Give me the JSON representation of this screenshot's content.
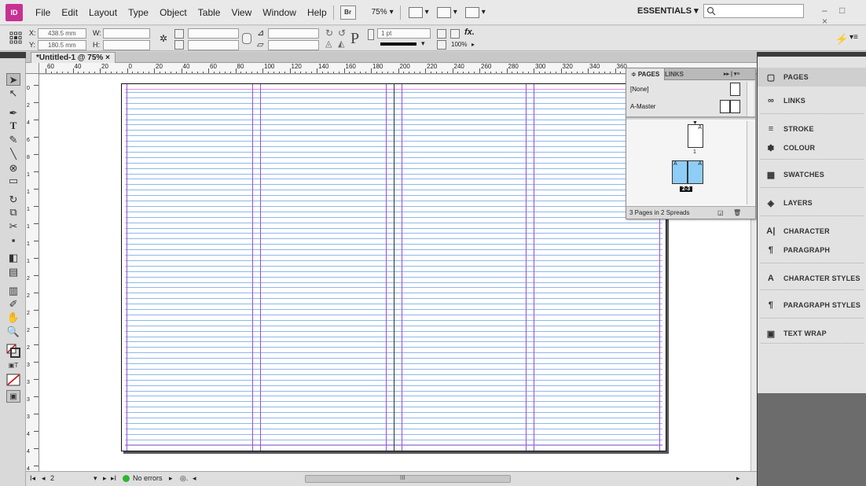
{
  "app": {
    "logo": "ID"
  },
  "menu": [
    "File",
    "Edit",
    "Layout",
    "Type",
    "Object",
    "Table",
    "View",
    "Window",
    "Help"
  ],
  "bridge_label": "Br",
  "zoom": "75%",
  "workspace": "ESSENTIALS ▾",
  "window_controls": "– □ ×",
  "control": {
    "x_label": "X:",
    "x_value": "438.5 mm",
    "y_label": "Y:",
    "y_value": "180.5 mm",
    "w_label": "W:",
    "h_label": "H:",
    "stroke_weight": "1 pt",
    "opacity": "100%",
    "fx": "fx."
  },
  "doc_tab": "*Untitled-1 @ 75% ×",
  "ruler_h": [
    "60",
    "40",
    "20",
    "0",
    "20",
    "40",
    "60",
    "80",
    "100",
    "120",
    "140",
    "160",
    "180",
    "200",
    "220",
    "240",
    "260",
    "280",
    "300",
    "320",
    "340",
    "360"
  ],
  "ruler_v": [
    "0",
    "2",
    "4",
    "6",
    "8",
    "1",
    "1",
    "1",
    "1",
    "1",
    "1",
    "2",
    "2",
    "2",
    "2",
    "2",
    "3",
    "3",
    "3",
    "3",
    "4",
    "4",
    "4"
  ],
  "status": {
    "page": "2",
    "errors": "No errors",
    "scroll_marker": "III"
  },
  "pages_panel": {
    "tab_pages": "≑ PAGES",
    "tab_links": "LINKS",
    "menu": "▸▸ | ▾≡",
    "master_none": "[None]",
    "master_a": "A-Master",
    "page1_number": "1",
    "spread_label": "2-3",
    "master_letter": "A",
    "footer": "3 Pages in 2 Spreads"
  },
  "dock": [
    {
      "label": "PAGES",
      "icon": "pages-icon",
      "glyph": "▢"
    },
    {
      "label": "LINKS",
      "icon": "links-icon",
      "glyph": "∞"
    },
    {
      "label": "STROKE",
      "icon": "stroke-icon",
      "glyph": "≡"
    },
    {
      "label": "COLOUR",
      "icon": "colour-icon",
      "glyph": "✽"
    },
    {
      "label": "SWATCHES",
      "icon": "swatches-icon",
      "glyph": "▦"
    },
    {
      "label": "LAYERS",
      "icon": "layers-icon",
      "glyph": "◈"
    },
    {
      "label": "CHARACTER",
      "icon": "character-icon",
      "glyph": "A|"
    },
    {
      "label": "PARAGRAPH",
      "icon": "paragraph-icon",
      "glyph": "¶"
    },
    {
      "label": "CHARACTER STYLES",
      "icon": "character-styles-icon",
      "glyph": "A"
    },
    {
      "label": "PARAGRAPH STYLES",
      "icon": "paragraph-styles-icon",
      "glyph": "¶"
    },
    {
      "label": "TEXT WRAP",
      "icon": "text-wrap-icon",
      "glyph": "▣"
    }
  ],
  "colors": {
    "margin_guide": "#d98fe0",
    "column_guide": "#9b4fd6",
    "baseline": "#8fb8e8",
    "accent": "#c73292"
  }
}
